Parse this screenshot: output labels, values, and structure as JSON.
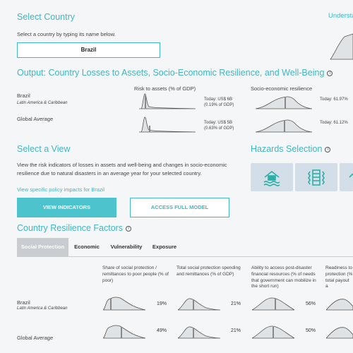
{
  "select_country": {
    "title": "Select Country",
    "help": "Select a country by typing its name below.",
    "value": "Brazil"
  },
  "understand_link": "Understa",
  "output": {
    "title": "Output: Country Losses to Assets, Socio-Economic Resilience, and Well-Being",
    "col_risk": "Risk to assets (% of GDP)",
    "col_resilience": "Socio-economic resilience",
    "rows": [
      {
        "name": "Brazil",
        "region": "Latin America & Caribbean",
        "risk_line1": "Today: US$ 6B",
        "risk_line2": "(0.19% of GDP)",
        "resilience": "Today: 61.97%"
      },
      {
        "name": "Global Average",
        "region": "",
        "risk_line1": "Today: US$ 5B",
        "risk_line2": "(0.63% of GDP)",
        "resilience": "Today: 61.12%"
      }
    ]
  },
  "select_view": {
    "title": "Select a View",
    "description": "View the risk indicators of losses in assets and well-being and changes in socio-economic resilience due to natural disasters in an average year for your selected country.",
    "policy_link": "View specific policy impacts for Brazil",
    "view_button": "VIEW INDICATORS",
    "model_button": "ACCESS FULL MODEL"
  },
  "hazards": {
    "title": "Hazards Selection",
    "items": [
      "flood-icon",
      "earthquake-icon",
      "hazard-icon"
    ]
  },
  "resilience_factors": {
    "title": "Country Resilience Factors",
    "tabs": [
      "Social Protection",
      "Economic",
      "Vulnerability",
      "Exposure"
    ],
    "active_tab": "Social Protection",
    "columns": [
      "Share of social protection / remittances to poor people (% of poor)",
      "Total social protection spending and remittances (% of GDP)",
      "Ability to access post-disaster financial resources (% of needs that government can mobilize in the short run)",
      "Readiness to protection (% total payout a"
    ],
    "rows": [
      {
        "name": "Brazil",
        "region": "Latin America & Caribbean",
        "values": [
          "19%",
          "21%",
          "56%"
        ]
      },
      {
        "name": "Global Average",
        "region": "",
        "values": [
          "49%",
          "21%",
          "50%"
        ]
      }
    ]
  },
  "colors": {
    "accent": "#3fb7c4",
    "hazard_bg": "#d3dee9",
    "tab_active": "#c9ccd0"
  }
}
